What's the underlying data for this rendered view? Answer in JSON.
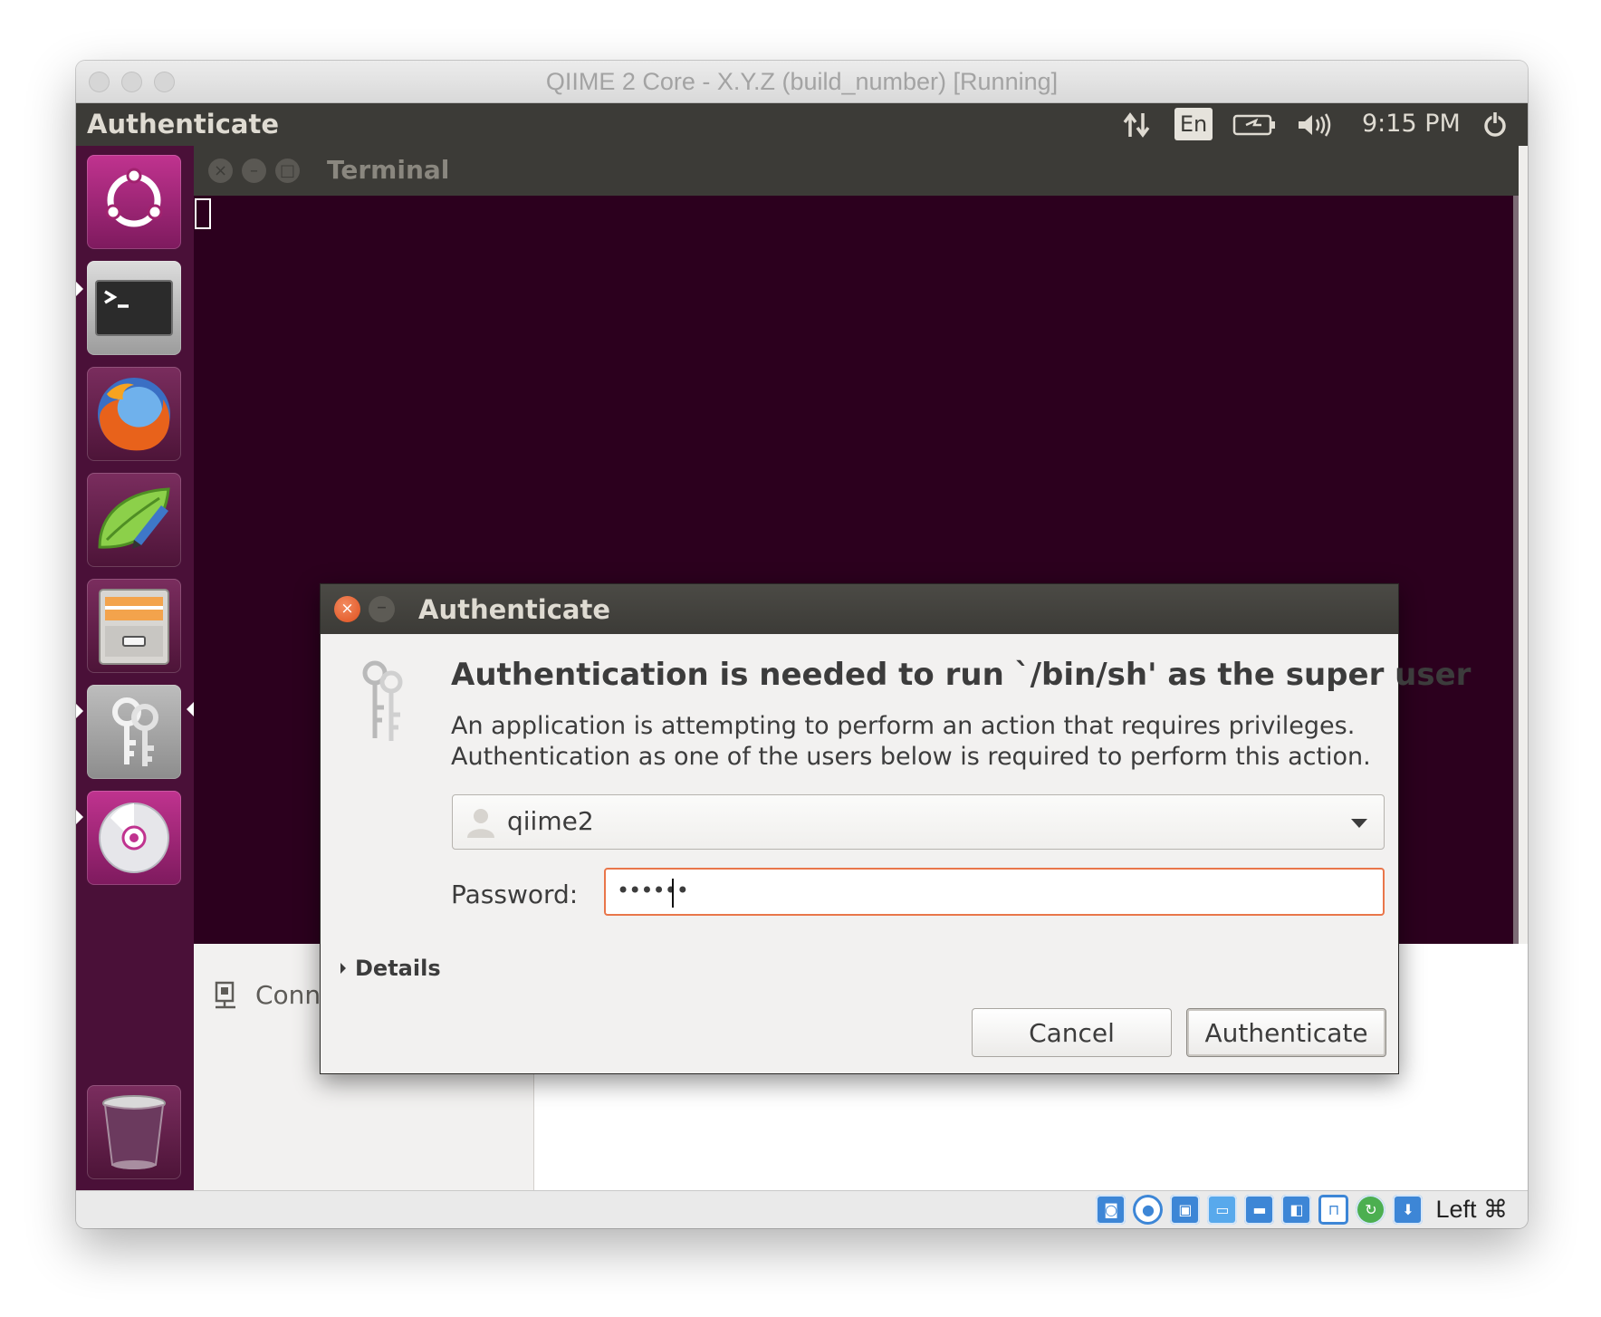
{
  "host": {
    "title": "QIIME 2 Core - X.Y.Z (build_number) [Running]"
  },
  "guest": {
    "topbar": {
      "app_title": "Authenticate",
      "keyboard_layout": "En",
      "clock": "9:15 PM"
    },
    "launcher": {
      "items": [
        {
          "name": "ubuntu-dash-icon"
        },
        {
          "name": "terminal-icon",
          "running": true
        },
        {
          "name": "firefox-icon"
        },
        {
          "name": "text-editor-icon"
        },
        {
          "name": "file-cabinet-icon"
        },
        {
          "name": "keys-icon",
          "running": true,
          "active": true
        },
        {
          "name": "disc-icon",
          "running": true
        },
        {
          "name": "trash-icon"
        }
      ]
    },
    "terminal": {
      "title": "Terminal"
    },
    "file_manager": {
      "sidebar_item": "Connect to Server"
    },
    "dialog": {
      "title": "Authenticate",
      "heading": "Authentication is needed to run `/bin/sh' as the super user",
      "description_line1": "An application is attempting to perform an action that requires privileges.",
      "description_line2": "Authentication as one of the users below is required to perform this action.",
      "selected_user": "qiime2",
      "password_label": "Password:",
      "password_mask": "••••••",
      "details_label": "Details",
      "cancel_label": "Cancel",
      "authenticate_label": "Authenticate",
      "accent_color": "#e9764a"
    }
  },
  "statusbar": {
    "host_key": "Left ⌘"
  }
}
